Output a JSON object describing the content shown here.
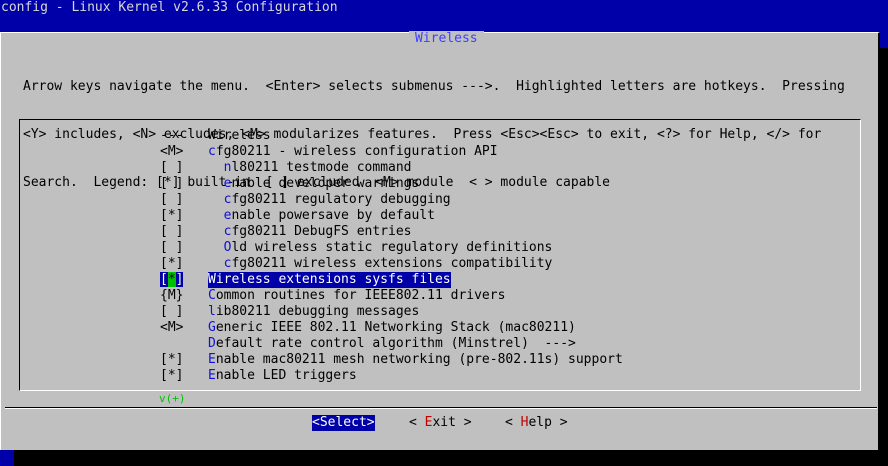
{
  "window": {
    "title": "config - Linux Kernel v2.6.33 Configuration"
  },
  "dialog": {
    "title": "Wireless",
    "help_lines": [
      "Arrow keys navigate the menu.  <Enter> selects submenus --->.  Highlighted letters are hotkeys.  Pressing",
      "<Y> includes, <N> excludes, <M> modularizes features.  Press <Esc><Esc> to exit, <?> for Help, </> for",
      "Search.  Legend: [*] built-in  [ ] excluded  <M> module  < > module capable"
    ]
  },
  "menu": {
    "items": [
      {
        "mark": "---",
        "hotkey": "",
        "rest": "Wireless",
        "indent": ""
      },
      {
        "mark": "<M>",
        "hotkey": "c",
        "rest": "fg80211 - wireless configuration API",
        "indent": ""
      },
      {
        "mark": "[ ]",
        "hotkey": "n",
        "rest": "l80211 testmode command",
        "indent": "  "
      },
      {
        "mark": "[ ]",
        "hotkey": "e",
        "rest": "nable developer warnings",
        "indent": "  "
      },
      {
        "mark": "[ ]",
        "hotkey": "c",
        "rest": "fg80211 regulatory debugging",
        "indent": "  "
      },
      {
        "mark": "[*]",
        "hotkey": "e",
        "rest": "nable powersave by default",
        "indent": "  "
      },
      {
        "mark": "[ ]",
        "hotkey": "c",
        "rest": "fg80211 DebugFS entries",
        "indent": "  "
      },
      {
        "mark": "[ ]",
        "hotkey": "O",
        "rest": "ld wireless static regulatory definitions",
        "indent": "  "
      },
      {
        "mark": "[*]",
        "hotkey": "c",
        "rest": "fg80211 wireless extensions compatibility",
        "indent": "  "
      },
      {
        "mark": "[*]",
        "hotkey": "",
        "rest": "Wireless extensions sysfs files",
        "indent": "",
        "selected": true
      },
      {
        "mark": "{M}",
        "hotkey": "C",
        "rest": "ommon routines for IEEE802.11 drivers",
        "indent": ""
      },
      {
        "mark": "[ ]",
        "hotkey": "l",
        "rest": "ib80211 debugging messages",
        "indent": ""
      },
      {
        "mark": "<M>",
        "hotkey": "G",
        "rest": "eneric IEEE 802.11 Networking Stack (mac80211)",
        "indent": ""
      },
      {
        "mark": "",
        "hotkey": "D",
        "rest": "efault rate control algorithm (Minstrel)  --->",
        "indent": ""
      },
      {
        "mark": "[*]",
        "hotkey": "E",
        "rest": "nable mac80211 mesh networking (pre-802.11s) support",
        "indent": ""
      },
      {
        "mark": "[*]",
        "hotkey": "E",
        "rest": "nable LED triggers",
        "indent": ""
      }
    ],
    "more_indicator": "v(+)"
  },
  "buttons": {
    "select": "<Select>",
    "exit_pre": "< ",
    "exit_hk": "E",
    "exit_post": "xit >",
    "help_pre": "< ",
    "help_hk": "H",
    "help_post": "elp >"
  }
}
